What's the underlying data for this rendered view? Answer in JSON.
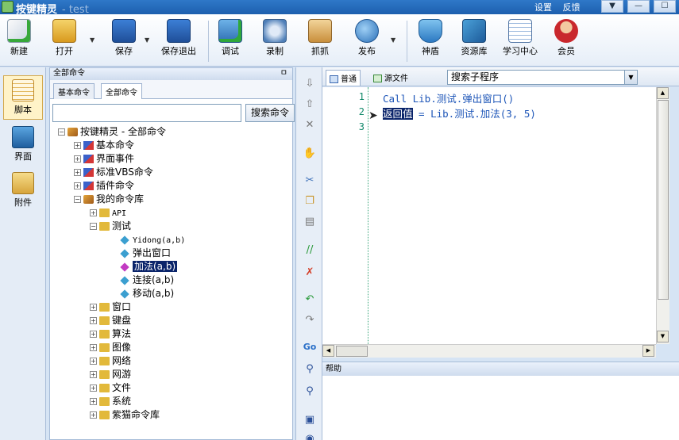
{
  "window": {
    "title": "按键精灵",
    "subtitle": "- test",
    "links": [
      "设置",
      "反馈"
    ]
  },
  "toolbar": {
    "buttons": [
      "新建",
      "打开",
      "保存",
      "保存退出",
      "调试",
      "录制",
      "抓抓",
      "发布",
      "神盾",
      "资源库",
      "学习中心",
      "会员"
    ]
  },
  "lefttabs": [
    "脚本",
    "界面",
    "附件"
  ],
  "panel": {
    "title": "全部命令",
    "pin": "ㅁ",
    "tabs": [
      "基本命令",
      "全部命令"
    ],
    "search_value": "",
    "search_button": "搜索命令"
  },
  "tree": {
    "root": "按键精灵 - 全部命令",
    "categories": [
      "基本命令",
      "界面事件",
      "标准VBS命令",
      "插件命令",
      "我的命令库"
    ],
    "mylib": {
      "api": "API",
      "test": "测试",
      "test_items": [
        "Yidong(a,b)",
        "弹出窗口",
        "加法(a,b)",
        "连接(a,b)",
        "移动(a,b)"
      ],
      "rest": [
        "窗口",
        "键盘",
        "算法",
        "图像",
        "网络",
        "网游",
        "文件",
        "系统",
        "紫猫命令库"
      ]
    }
  },
  "editor": {
    "tabs": [
      "普通",
      "源文件"
    ],
    "sub_select": "搜索子程序",
    "line_numbers": [
      "1",
      "2",
      "3"
    ],
    "line1": "Call Lib.测试.弹出窗口()",
    "line2_hl": "返回值",
    "line2_rest": " = Lib.测试.加法(3, 5)"
  },
  "help": {
    "title": "帮助"
  },
  "colors": {
    "selection": "#0a246a",
    "code": "#1e56b8",
    "line_number": "#138a6b"
  }
}
